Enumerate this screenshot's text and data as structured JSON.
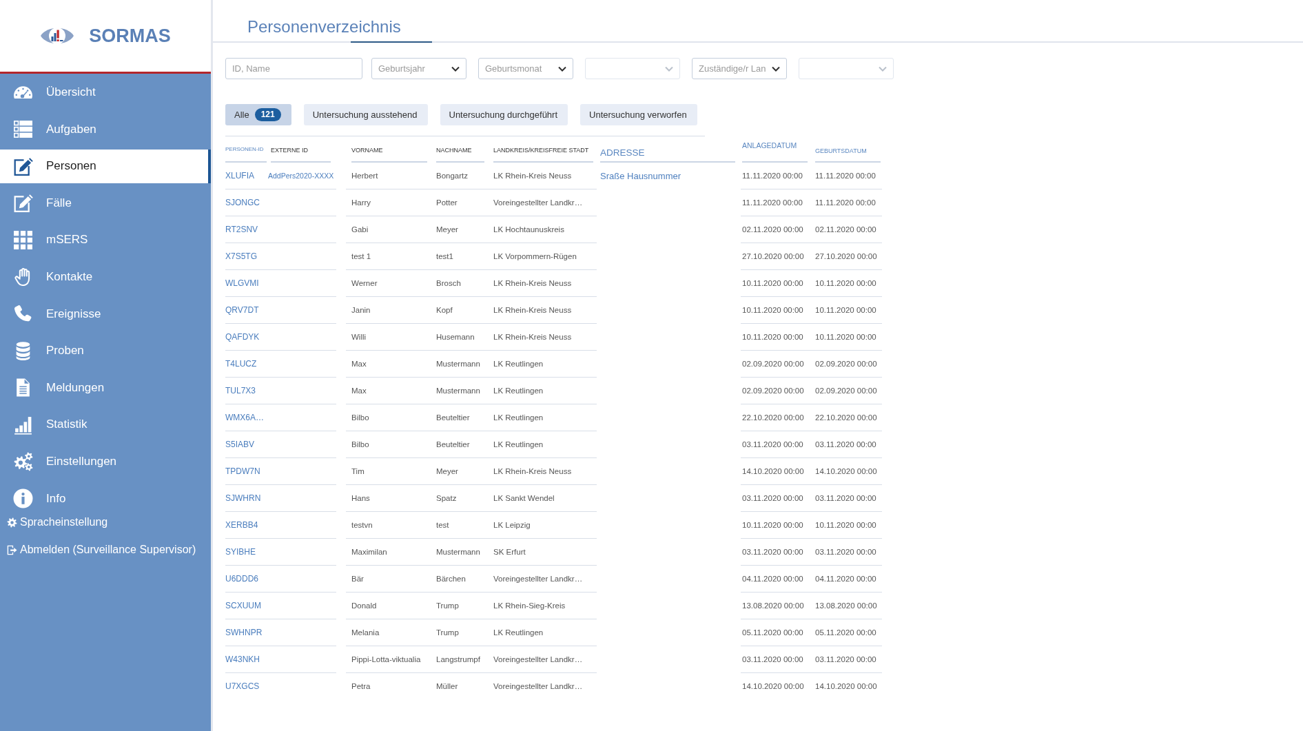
{
  "sidebar": {
    "logo": {
      "text": "SORMAS"
    },
    "items": [
      {
        "label": "Übersicht",
        "selected": false
      },
      {
        "label": "Aufgaben",
        "selected": false
      },
      {
        "label": "Personen",
        "selected": true
      },
      {
        "label": "Fälle",
        "selected": false
      },
      {
        "label": "mSERS",
        "selected": false
      },
      {
        "label": "Kontakte",
        "selected": false
      },
      {
        "label": "Ereignisse",
        "selected": false
      },
      {
        "label": "Proben",
        "selected": false
      },
      {
        "label": "Meldungen",
        "selected": false
      },
      {
        "label": "Statistik",
        "selected": false
      },
      {
        "label": "Einstellungen",
        "selected": false
      },
      {
        "label": "Info",
        "selected": false
      }
    ],
    "footer_links": [
      {
        "label": "Spracheinstellung"
      },
      {
        "label": "Abmelden (Surveillance Supervisor)"
      }
    ]
  },
  "page": {
    "title": "Personenverzeichnis"
  },
  "filters": {
    "search": {
      "placeholder": "ID, Name"
    },
    "dropdowns": [
      {
        "placeholder": "Geburtsjahr",
        "disabled": false
      },
      {
        "placeholder": "Geburtsmonat",
        "disabled": false
      },
      {
        "disabled": true
      },
      {
        "placeholder": "Zuständige/r Lan",
        "disabled": false
      },
      {
        "disabled": true
      }
    ]
  },
  "status_filters": [
    {
      "label": "Alle",
      "count": "121",
      "selected": true
    },
    {
      "label": "Untersuchung ausstehend",
      "selected": false
    },
    {
      "label": "Untersuchung durchgeführt",
      "selected": false
    },
    {
      "label": "Untersuchung verworfen",
      "selected": false
    }
  ],
  "table": {
    "columns": [
      "PERSONEN-ID",
      "EXTERNE ID",
      "VORNAME",
      "NACHNAME",
      "LANDKREIS/KREISFREIE STADT",
      "ADRESSE",
      "ANLAGEDATUM",
      "GEBURTSDATUM"
    ],
    "rows": [
      {
        "person_id": "XLUFIA",
        "external_id": "AddPers2020-XXXX",
        "first_name": "Herbert",
        "last_name": "Bongartz",
        "district": "LK Rhein-Kreis Neuss",
        "address": "Sraße Hausnummer",
        "created": "11.11.2020 00:00",
        "birth_date": "11.11.2020 00:00"
      },
      {
        "person_id": "SJONGC",
        "first_name": "Harry",
        "last_name": "Potter",
        "district": "Voreingestellter Landkr…",
        "created": "11.11.2020 00:00",
        "birth_date": "11.11.2020 00:00"
      },
      {
        "person_id": "RT2SNV",
        "first_name": "Gabi",
        "last_name": "Meyer",
        "district": "LK Hochtaunuskreis",
        "created": "02.11.2020 00:00",
        "birth_date": "02.11.2020 00:00"
      },
      {
        "person_id": "X7S5TG",
        "first_name": "test 1",
        "last_name": "test1",
        "district": "LK Vorpommern-Rügen",
        "created": "27.10.2020 00:00",
        "birth_date": "27.10.2020 00:00"
      },
      {
        "person_id": "WLGVMI",
        "first_name": "Werner",
        "last_name": "Brosch",
        "district": "LK Rhein-Kreis Neuss",
        "created": "10.11.2020 00:00",
        "birth_date": "10.11.2020 00:00"
      },
      {
        "person_id": "QRV7DT",
        "first_name": "Janin",
        "last_name": "Kopf",
        "district": "LK Rhein-Kreis Neuss",
        "created": "10.11.2020 00:00",
        "birth_date": "10.11.2020 00:00"
      },
      {
        "person_id": "QAFDYK",
        "first_name": "Willi",
        "last_name": "Husemann",
        "district": "LK Rhein-Kreis Neuss",
        "created": "10.11.2020 00:00",
        "birth_date": "10.11.2020 00:00"
      },
      {
        "person_id": "T4LUCZ",
        "first_name": "Max",
        "last_name": "Mustermann",
        "district": "LK Reutlingen",
        "created": "02.09.2020 00:00",
        "birth_date": "02.09.2020 00:00"
      },
      {
        "person_id": "TUL7X3",
        "first_name": "Max",
        "last_name": "Mustermann",
        "district": "LK Reutlingen",
        "created": "02.09.2020 00:00",
        "birth_date": "02.09.2020 00:00"
      },
      {
        "person_id": "WMX6A…",
        "first_name": "Bilbo",
        "last_name": "Beuteltier",
        "district": "LK Reutlingen",
        "created": "22.10.2020 00:00",
        "birth_date": "22.10.2020 00:00"
      },
      {
        "person_id": "S5IABV",
        "first_name": "Bilbo",
        "last_name": "Beuteltier",
        "district": "LK Reutlingen",
        "created": "03.11.2020 00:00",
        "birth_date": "03.11.2020 00:00"
      },
      {
        "person_id": "TPDW7N",
        "first_name": "Tim",
        "last_name": "Meyer",
        "district": "LK Rhein-Kreis Neuss",
        "created": "14.10.2020 00:00",
        "birth_date": "14.10.2020 00:00"
      },
      {
        "person_id": "SJWHRN",
        "first_name": "Hans",
        "last_name": "Spatz",
        "district": "LK Sankt Wendel",
        "created": "03.11.2020 00:00",
        "birth_date": "03.11.2020 00:00"
      },
      {
        "person_id": "XERBB4",
        "first_name": "testvn",
        "last_name": "test",
        "district": "LK Leipzig",
        "created": "10.11.2020 00:00",
        "birth_date": "10.11.2020 00:00"
      },
      {
        "person_id": "SYIBHE",
        "first_name": "Maximilan",
        "last_name": "Mustermann",
        "district": "SK Erfurt",
        "created": "03.11.2020 00:00",
        "birth_date": "03.11.2020 00:00"
      },
      {
        "person_id": "U6DDD6",
        "first_name": "Bär",
        "last_name": "Bärchen",
        "district": "Voreingestellter Landkr…",
        "created": "04.11.2020 00:00",
        "birth_date": "04.11.2020 00:00"
      },
      {
        "person_id": "SCXUUM",
        "first_name": "Donald",
        "last_name": "Trump",
        "district": "LK Rhein-Sieg-Kreis",
        "created": "13.08.2020 00:00",
        "birth_date": "13.08.2020 00:00"
      },
      {
        "person_id": "SWHNPR",
        "first_name": "Melania",
        "last_name": "Trump",
        "district": "LK Reutlingen",
        "created": "05.11.2020 00:00",
        "birth_date": "05.11.2020 00:00"
      },
      {
        "person_id": "W43NKH",
        "first_name": "Pippi-Lotta-viktualia",
        "last_name": "Langstrumpf",
        "district": "Voreingestellter Landkr…",
        "created": "03.11.2020 00:00",
        "birth_date": "03.11.2020 00:00"
      },
      {
        "person_id": "U7XGCS",
        "first_name": "Petra",
        "last_name": "Müller",
        "district": "Voreingestellter Landkr…",
        "created": "14.10.2020 00:00",
        "birth_date": "14.10.2020 00:00"
      }
    ]
  }
}
